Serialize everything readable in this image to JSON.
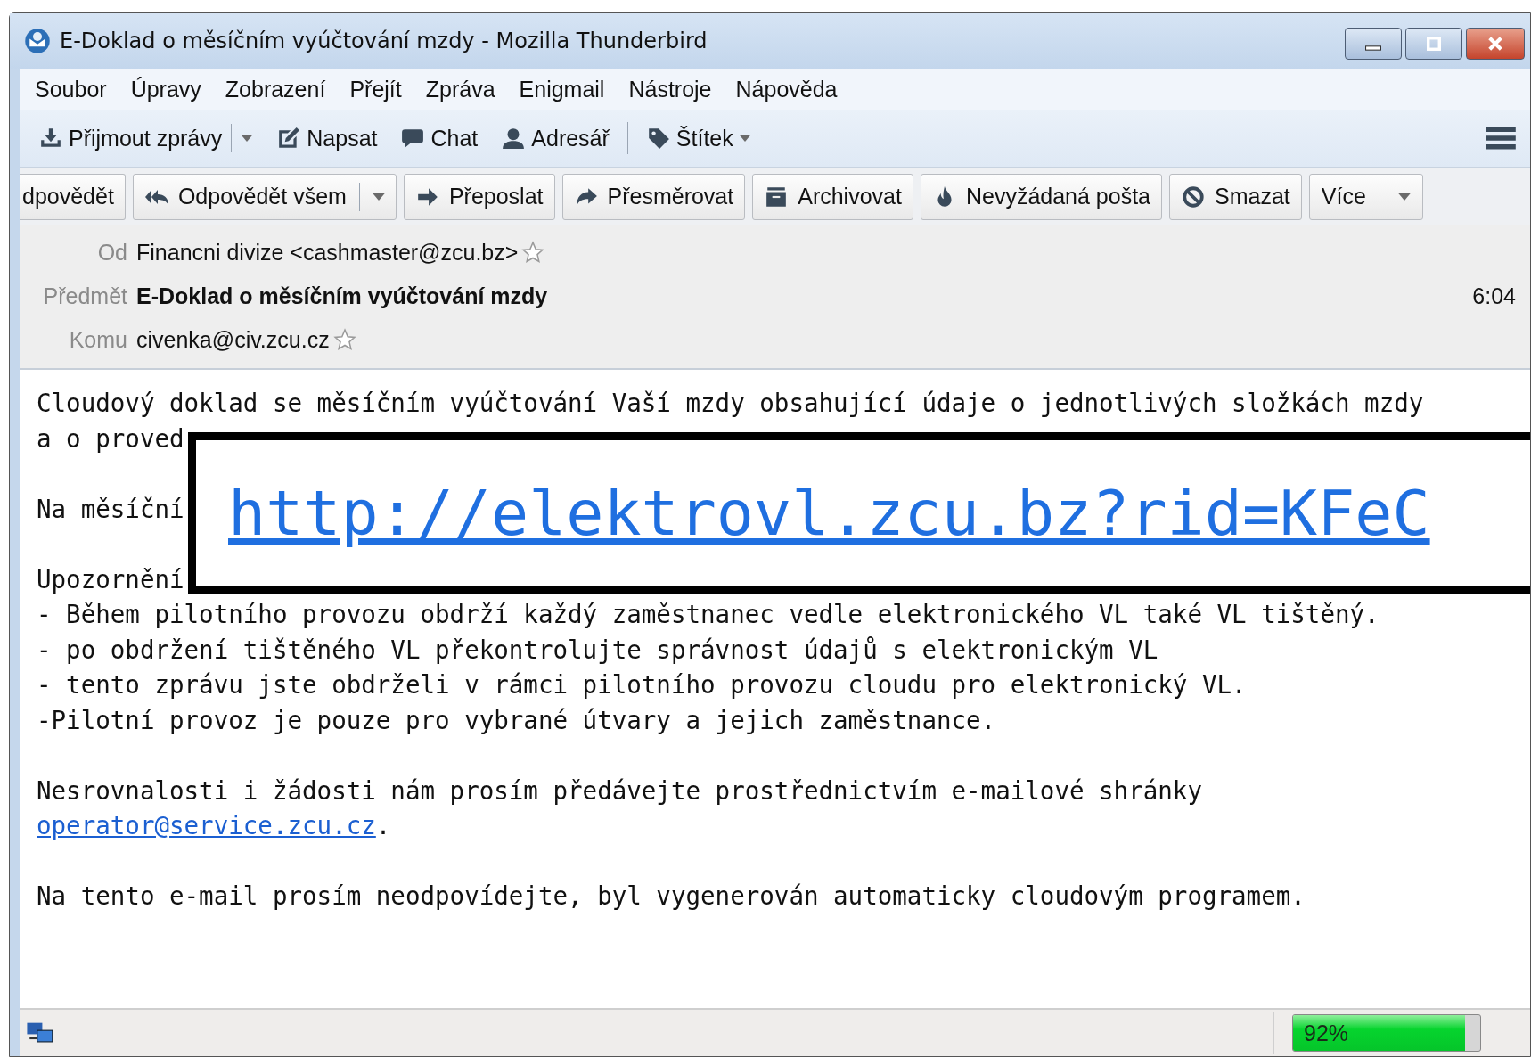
{
  "window": {
    "title": "E-Doklad o měsíčním vyúčtování mzdy - Mozilla Thunderbird"
  },
  "menu": [
    "Soubor",
    "Úpravy",
    "Zobrazení",
    "Přejít",
    "Zpráva",
    "Enigmail",
    "Nástroje",
    "Nápověda"
  ],
  "toolbar": [
    {
      "label": "Přijmout zprávy",
      "kind": "split"
    },
    {
      "label": "Napsat",
      "kind": "plain"
    },
    {
      "label": "Chat",
      "kind": "plain"
    },
    {
      "label": "Adresář",
      "kind": "plain"
    },
    {
      "label": "Štítek",
      "kind": "menu"
    }
  ],
  "message_toolbar": [
    {
      "label": "dpovědět",
      "kind": "plain"
    },
    {
      "label": "Odpovědět všem",
      "kind": "split"
    },
    {
      "label": "Přeposlat",
      "kind": "plain"
    },
    {
      "label": "Přesměrovat",
      "kind": "plain"
    },
    {
      "label": "Archivovat",
      "kind": "plain"
    },
    {
      "label": "Nevyžádaná pošta",
      "kind": "plain"
    },
    {
      "label": "Smazat",
      "kind": "plain"
    },
    {
      "label": "Více",
      "kind": "menu"
    }
  ],
  "header": {
    "date": "6:04",
    "fields": [
      {
        "label": "Od",
        "value": "Financni divize <cashmaster@zcu.bz>",
        "kind": "address",
        "starred": false
      },
      {
        "label": "Předmět",
        "value": "E-Doklad o měsíčním vyúčtování mzdy",
        "kind": "subject"
      },
      {
        "label": "Komu",
        "value": "civenka@civ.zcu.cz",
        "kind": "address",
        "starred": false
      }
    ]
  },
  "body": {
    "paragraphs": [
      {
        "lines": [
          {
            "kind": "text",
            "text": "Cloudový doklad se měsíčním vyúčtování Vaší mzdy obsahující údaje o jednotlivých složkách mzdy"
          },
          {
            "kind": "text",
            "text": "a o proved"
          }
        ]
      },
      {
        "lines": [
          {
            "kind": "text",
            "text": "Na měsíční"
          }
        ]
      },
      {
        "lines": [
          {
            "kind": "text",
            "text": "Upozornění"
          },
          {
            "kind": "text",
            "text": "- Během pilotního provozu obdrží každý zaměstnanec vedle elektronického VL také VL tištěný."
          },
          {
            "kind": "text",
            "text": "- po obdržení tištěného VL překontrolujte správnost údajů s elektronickým VL"
          },
          {
            "kind": "text",
            "text": "- tento zprávu jste obdrželi v rámci pilotního provozu cloudu pro elektronický VL."
          },
          {
            "kind": "text",
            "text": "-Pilotní provoz je pouze pro vybrané útvary a jejich zaměstnance."
          }
        ]
      },
      {
        "lines": [
          {
            "kind": "text",
            "text": "Nesrovnalosti i žádosti nám prosím předávejte prostřednictvím e-mailové shránky"
          },
          {
            "kind": "link",
            "link": "operator@service.zcu.cz",
            "text": "."
          }
        ]
      },
      {
        "lines": [
          {
            "kind": "text",
            "text": "Na tento e-mail prosím neodpovídejte, byl vygenerován automaticky cloudovým programem."
          }
        ]
      }
    ],
    "overlay": {
      "url": "http://elektrovl.zcu.bz?rid=KFeC"
    }
  },
  "status_bar": {
    "zoom": {
      "level": 0.92,
      "reading": "92%"
    }
  }
}
